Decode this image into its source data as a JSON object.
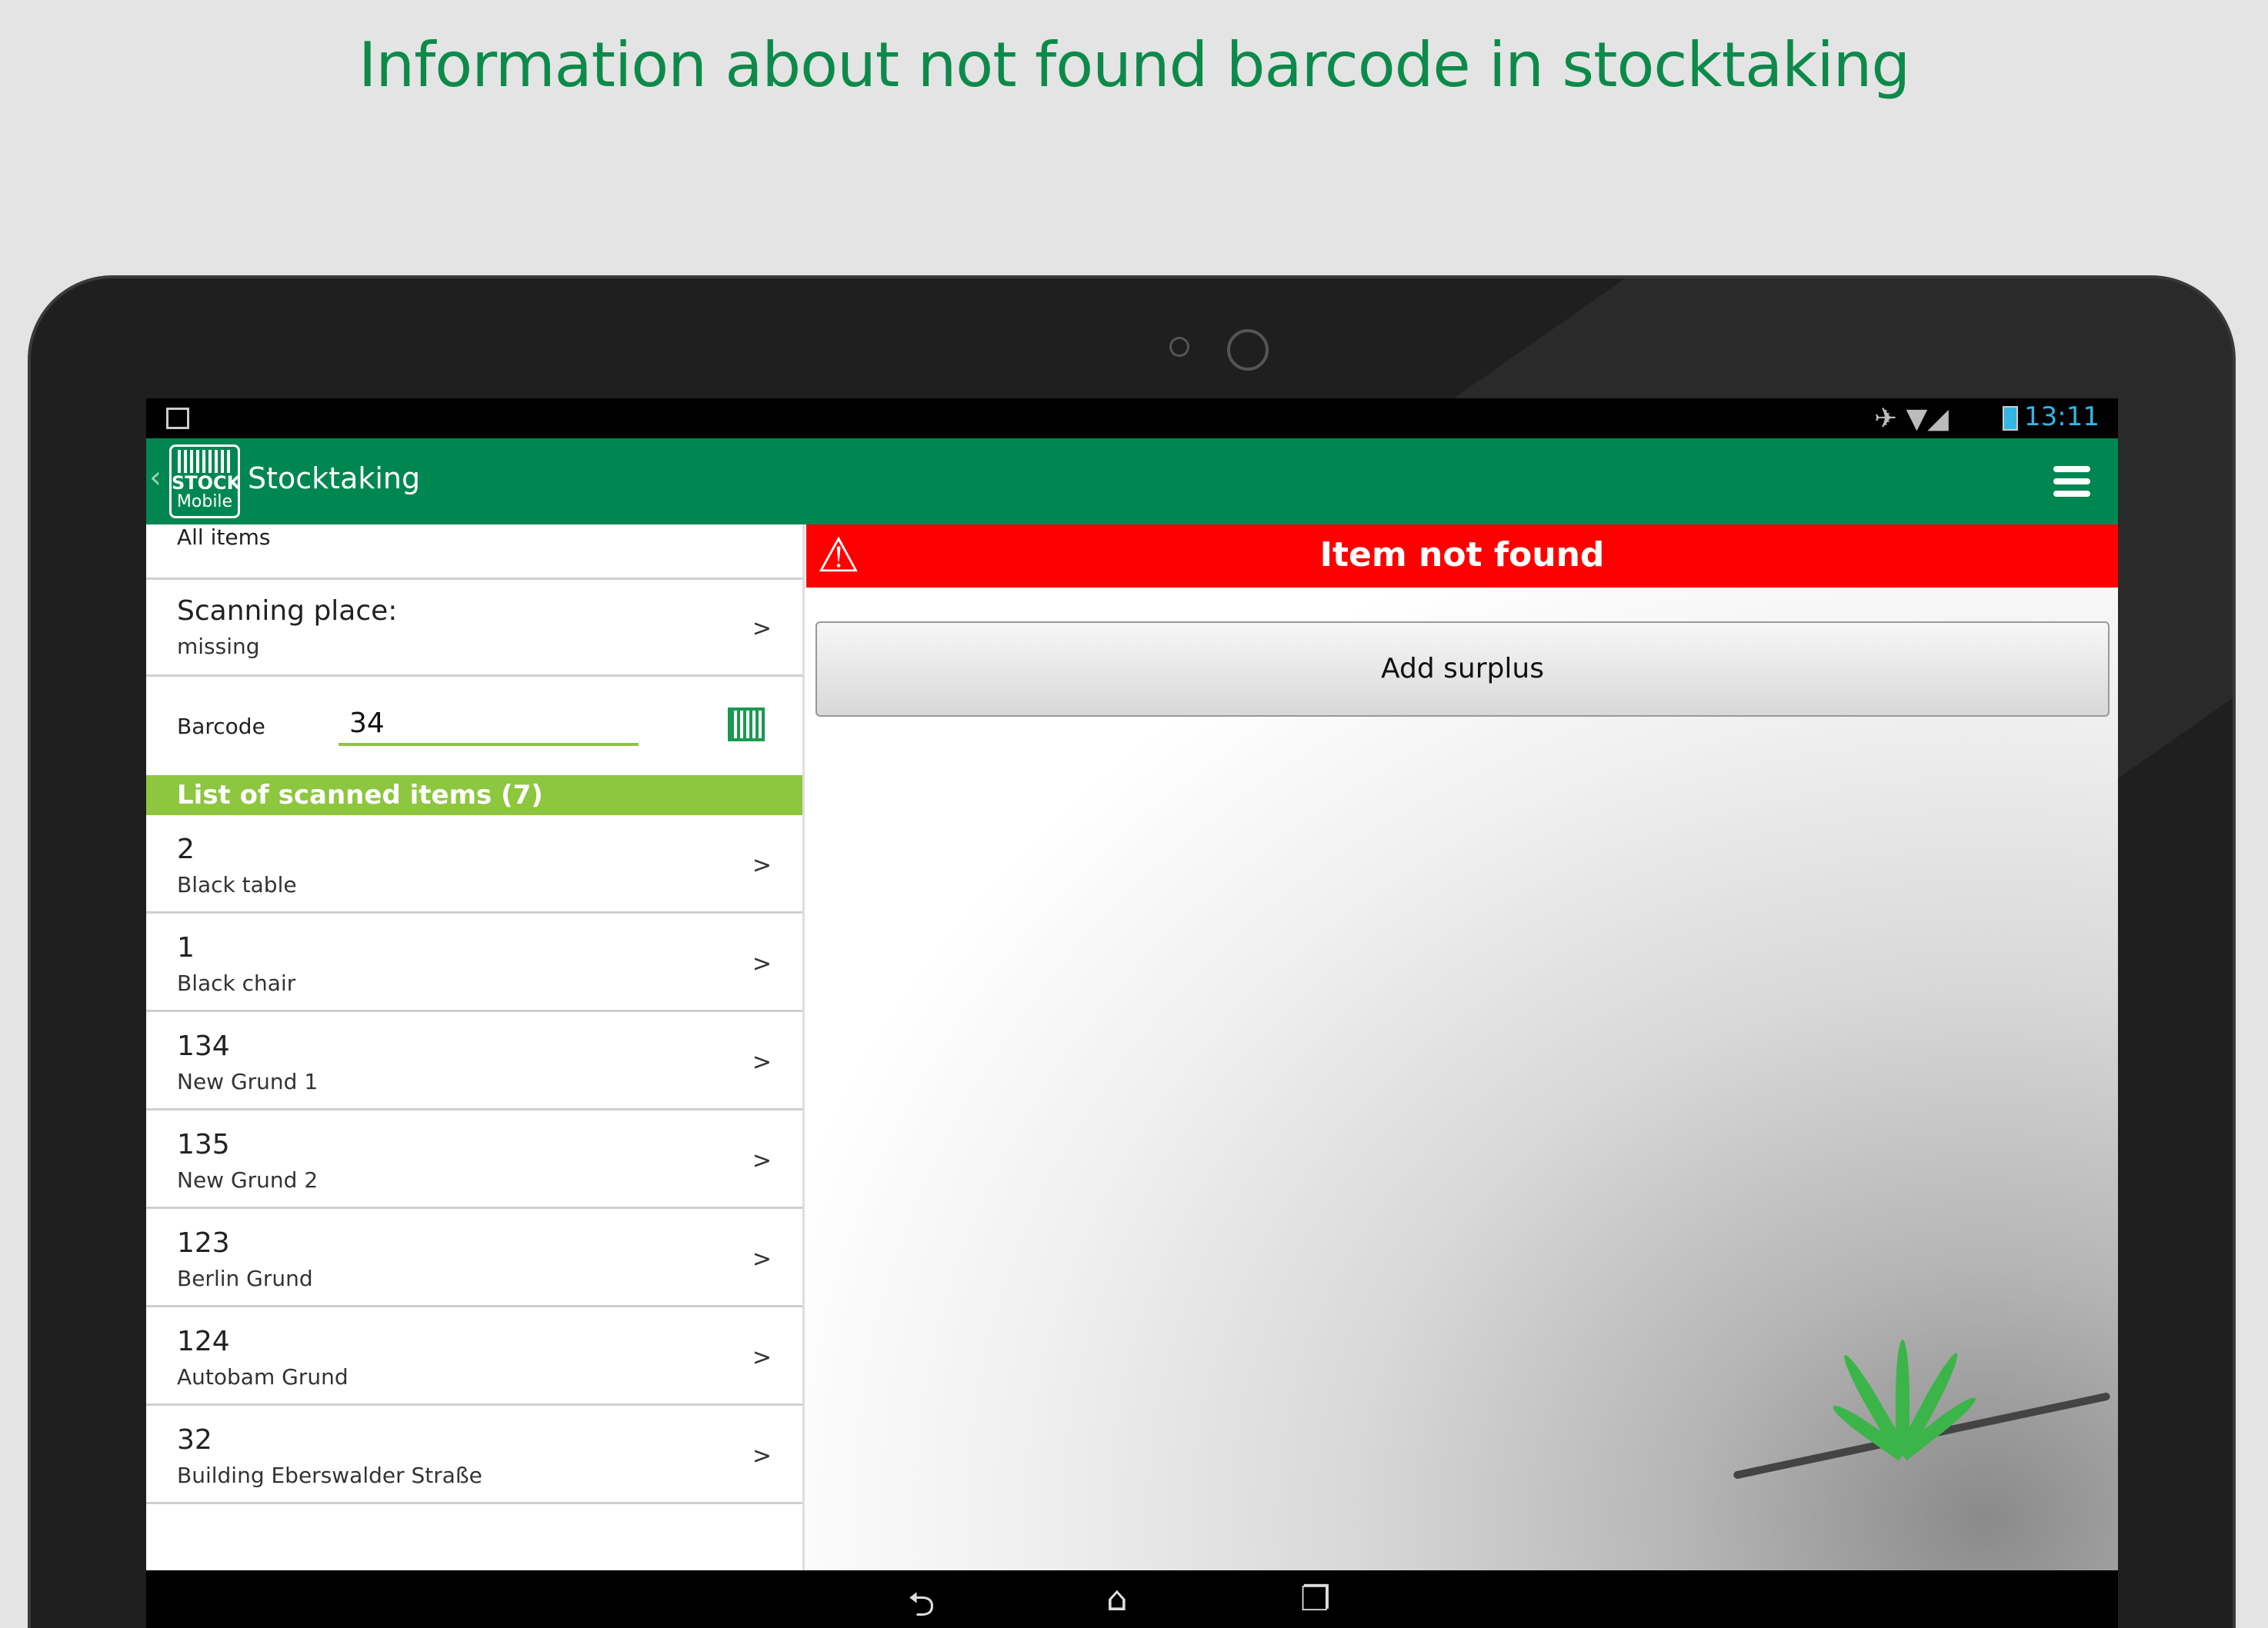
{
  "headline": "Information about not found barcode in stocktaking",
  "status_bar": {
    "time": "13:11",
    "icons": "✈ ▼◢"
  },
  "action_bar": {
    "logo_line1": "STOCK",
    "logo_line2": "Mobile",
    "title": "Stocktaking"
  },
  "left_panel": {
    "all_items": "All items",
    "scanning_place_label": "Scanning place:",
    "scanning_place_value": "missing",
    "barcode_label": "Barcode",
    "barcode_value": "34",
    "list_header": "List of scanned items (7)",
    "chevron": ">",
    "items": [
      {
        "number": "2",
        "name": "Black table"
      },
      {
        "number": "1",
        "name": "Black chair"
      },
      {
        "number": "134",
        "name": "New Grund 1"
      },
      {
        "number": "135",
        "name": "New Grund 2"
      },
      {
        "number": "123",
        "name": "Berlin Grund"
      },
      {
        "number": "124",
        "name": "Autobam Grund"
      },
      {
        "number": "32",
        "name": "Building Eberswalder Straße"
      }
    ]
  },
  "right_panel": {
    "alert_title": "Item not found",
    "add_surplus_label": "Add surplus"
  },
  "nav": {
    "back_icon": "back-icon",
    "home_icon": "home-icon",
    "recent_icon": "recent-apps-icon"
  },
  "colors": {
    "brand_green": "#008751",
    "list_header_green": "#8dc63f",
    "alert_red": "#ff0000",
    "headline_green": "#0d8a4a"
  }
}
